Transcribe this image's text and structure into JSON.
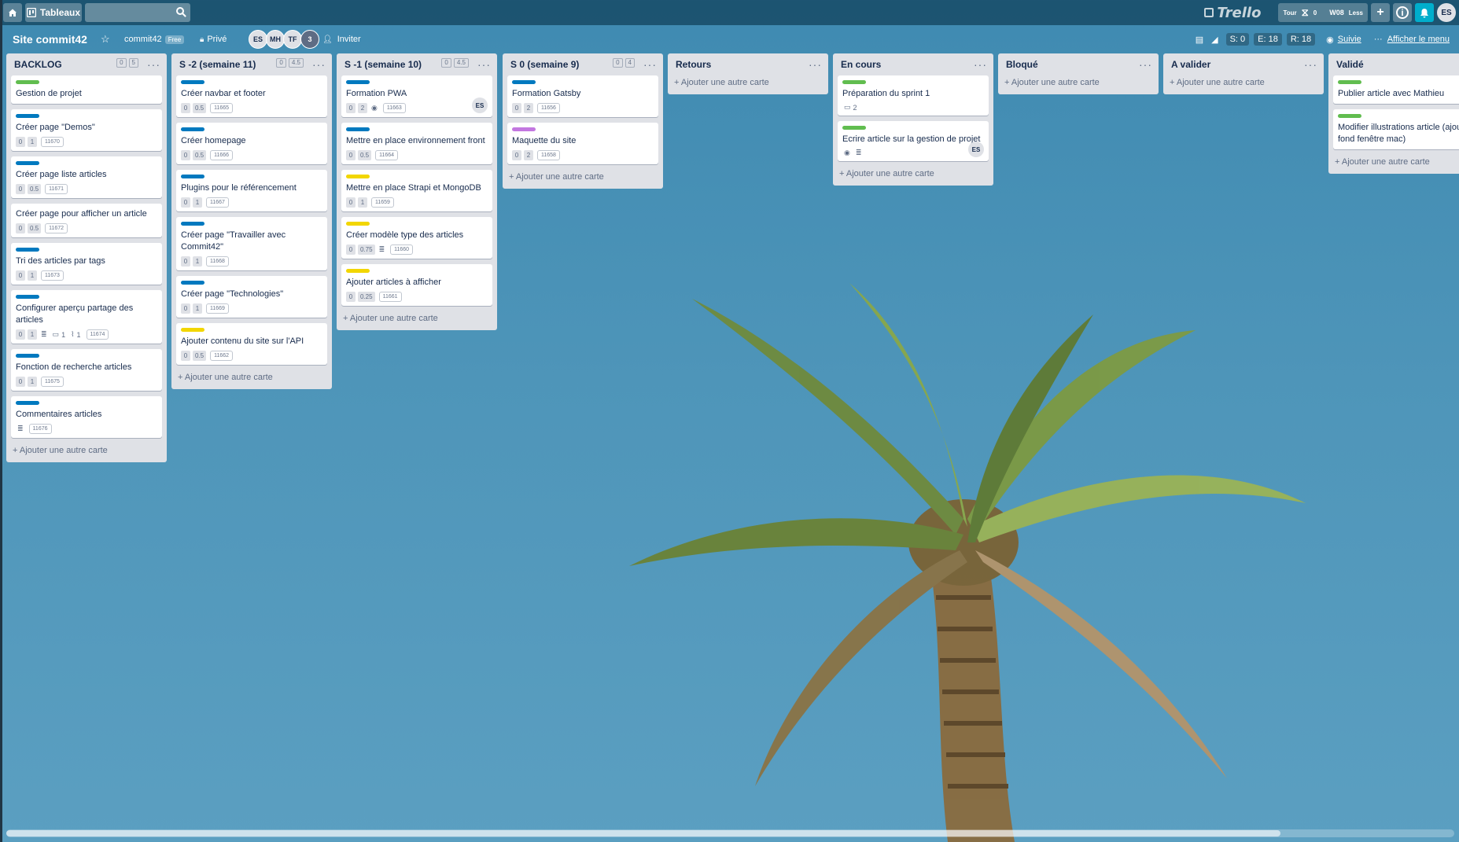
{
  "topbar": {
    "home_icon": "home-icon",
    "boards_label": "Tableaux",
    "search_placeholder": "",
    "logo_text": "Trello",
    "tour_label": "Tour",
    "tour_count": "0",
    "w08_label": "W08",
    "less_label": "Less",
    "user_initials": "ES"
  },
  "board": {
    "title": "Site commit42",
    "team": "commit42",
    "team_badge": "Free",
    "visibility": "Privé",
    "members": [
      "ES",
      "MH",
      "TF"
    ],
    "member_count": "3",
    "invite_label": "Inviter",
    "stats": {
      "s": "S: 0",
      "e": "E: 18",
      "r": "R: 18"
    },
    "follow_label": "Suivie",
    "menu_label": "Afficher le menu"
  },
  "add_card_label": "+ Ajouter une autre carte",
  "colors": {
    "green": "#61bd4f",
    "blue": "#0079bf",
    "yellow": "#f2d600",
    "purple": "#c377e0"
  },
  "lists": [
    {
      "title": "BACKLOG",
      "badges": [
        "0",
        "5"
      ],
      "cards": [
        {
          "label": "green",
          "title": "Gestion de projet",
          "badges": []
        },
        {
          "label": "blue",
          "title": "Créer page \"Demos\"",
          "badges": [
            "0",
            "1"
          ],
          "id": "11670"
        },
        {
          "label": "blue",
          "title": "Créer page liste articles",
          "badges": [
            "0",
            "0.5"
          ],
          "id": "11671"
        },
        {
          "label": "",
          "title": "Créer page pour afficher un article",
          "badges": [
            "0",
            "0.5"
          ],
          "id": "11672"
        },
        {
          "label": "blue",
          "title": "Tri des articles par tags",
          "badges": [
            "0",
            "1"
          ],
          "id": "11673"
        },
        {
          "label": "blue",
          "title": "Configurer aperçu partage des articles",
          "badges": [
            "0",
            "1"
          ],
          "desc": true,
          "comments": "1",
          "attachments": "1",
          "id": "11674"
        },
        {
          "label": "blue",
          "title": "Fonction de recherche articles",
          "badges": [
            "0",
            "1"
          ],
          "id": "11675"
        },
        {
          "label": "blue",
          "title": "Commentaires articles",
          "badges": [],
          "desc": true,
          "id": "11676"
        }
      ]
    },
    {
      "title": "S -2 (semaine 11)",
      "badges": [
        "0",
        "4.5"
      ],
      "cards": [
        {
          "label": "blue",
          "title": "Créer navbar et footer",
          "badges": [
            "0",
            "0.5"
          ],
          "id": "11665"
        },
        {
          "label": "blue",
          "title": "Créer homepage",
          "badges": [
            "0",
            "0.5"
          ],
          "id": "11666"
        },
        {
          "label": "blue",
          "title": "Plugins pour le référencement",
          "badges": [
            "0",
            "1"
          ],
          "id": "11667"
        },
        {
          "label": "blue",
          "title": "Créer page \"Travailler avec Commit42\"",
          "badges": [
            "0",
            "1"
          ],
          "id": "11668"
        },
        {
          "label": "blue",
          "title": "Créer page \"Technologies\"",
          "badges": [
            "0",
            "1"
          ],
          "id": "11669"
        },
        {
          "label": "yellow",
          "title": "Ajouter contenu du site sur l'API",
          "badges": [
            "0",
            "0.5"
          ],
          "id": "11662"
        }
      ]
    },
    {
      "title": "S -1 (semaine 10)",
      "badges": [
        "0",
        "4.5"
      ],
      "cards": [
        {
          "label": "blue",
          "title": "Formation PWA",
          "badges": [
            "0",
            "2"
          ],
          "watch": true,
          "id": "11663",
          "member": "ES"
        },
        {
          "label": "blue",
          "title": "Mettre en place environnement front",
          "badges": [
            "0",
            "0.5"
          ],
          "id": "11664"
        },
        {
          "label": "yellow",
          "title": "Mettre en place Strapi et MongoDB",
          "badges": [
            "0",
            "1"
          ],
          "id": "11659"
        },
        {
          "label": "yellow",
          "title": "Créer modèle type des articles",
          "badges": [
            "0",
            "0.75"
          ],
          "desc": true,
          "id": "11660"
        },
        {
          "label": "yellow",
          "title": "Ajouter articles à afficher",
          "badges": [
            "0",
            "0.25"
          ],
          "id": "11661"
        }
      ]
    },
    {
      "title": "S 0 (semaine 9)",
      "badges": [
        "0",
        "4"
      ],
      "cards": [
        {
          "label": "blue",
          "title": "Formation Gatsby",
          "badges": [
            "0",
            "2"
          ],
          "id": "11656"
        },
        {
          "label": "purple",
          "title": "Maquette du site",
          "badges": [
            "0",
            "2"
          ],
          "id": "11658"
        }
      ]
    },
    {
      "title": "Retours",
      "badges": [],
      "cards": []
    },
    {
      "title": "En cours",
      "badges": [],
      "cards": [
        {
          "label": "green",
          "title": "Préparation du sprint 1",
          "badges": [],
          "comments": "2"
        },
        {
          "label": "green",
          "title": "Ecrire article sur la gestion de projet",
          "badges": [],
          "watch": true,
          "desc": true,
          "member": "ES"
        }
      ]
    },
    {
      "title": "Bloqué",
      "badges": [],
      "cards": []
    },
    {
      "title": "A valider",
      "badges": [],
      "cards": []
    },
    {
      "title": "Validé",
      "badges": [],
      "cards": [
        {
          "label": "green",
          "title": "Publier article avec Mathieu",
          "badges": []
        },
        {
          "label": "green",
          "title": "Modifier illustrations article (ajout fond fenêtre mac)",
          "badges": []
        }
      ]
    }
  ]
}
